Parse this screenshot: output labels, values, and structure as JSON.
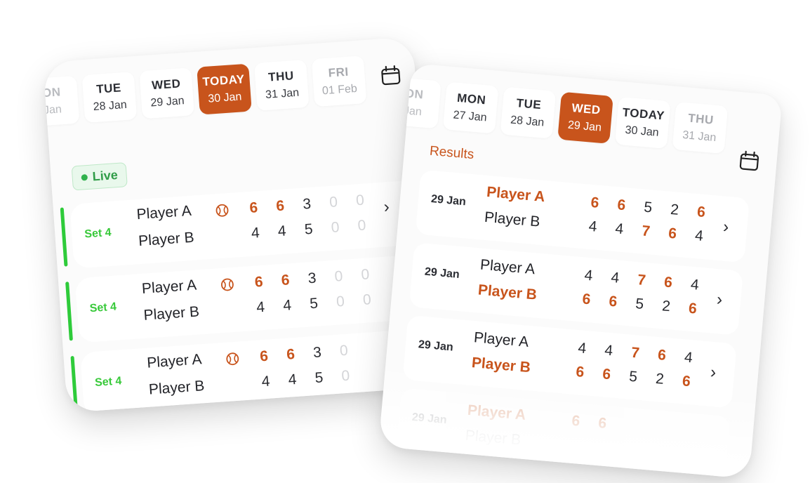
{
  "left_card": {
    "days": [
      {
        "name": "ON",
        "date": "Jan",
        "state": "edge"
      },
      {
        "name": "TUE",
        "date": "28 Jan",
        "state": "normal"
      },
      {
        "name": "WED",
        "date": "29 Jan",
        "state": "normal"
      },
      {
        "name": "TODAY",
        "date": "30 Jan",
        "state": "active"
      },
      {
        "name": "THU",
        "date": "31 Jan",
        "state": "normal"
      },
      {
        "name": "FRI",
        "date": "01 Feb",
        "state": "faded"
      }
    ],
    "live_label": "Live",
    "matches": [
      {
        "set": "Set 4",
        "player_a": "Player A",
        "player_b": "Player B",
        "a_scores": [
          "6",
          "6",
          "3",
          "0",
          "0"
        ],
        "b_scores": [
          "4",
          "4",
          "5",
          "0",
          "0"
        ]
      },
      {
        "set": "Set 4",
        "player_a": "Player A",
        "player_b": "Player B",
        "a_scores": [
          "6",
          "6",
          "3",
          "0",
          "0"
        ],
        "b_scores": [
          "4",
          "4",
          "5",
          "0",
          "0"
        ]
      },
      {
        "set": "Set 4",
        "player_a": "Player A",
        "player_b": "Player B",
        "a_scores": [
          "6",
          "6",
          "3",
          "0"
        ],
        "b_scores": [
          "4",
          "4",
          "5",
          "0"
        ]
      }
    ]
  },
  "right_card": {
    "days": [
      {
        "name": "ON",
        "date": "Jan",
        "state": "edge"
      },
      {
        "name": "MON",
        "date": "27 Jan",
        "state": "normal"
      },
      {
        "name": "TUE",
        "date": "28 Jan",
        "state": "normal"
      },
      {
        "name": "WED",
        "date": "29 Jan",
        "state": "active"
      },
      {
        "name": "TODAY",
        "date": "30 Jan",
        "state": "normal"
      },
      {
        "name": "THU",
        "date": "31 Jan",
        "state": "faded"
      }
    ],
    "results_title": "Results",
    "results": [
      {
        "date": "29 Jan",
        "player_a": "Player A",
        "player_b": "Player B",
        "winner": "a",
        "a_scores": [
          "6",
          "6",
          "5",
          "2",
          "6"
        ],
        "b_scores": [
          "4",
          "4",
          "7",
          "6",
          "4"
        ]
      },
      {
        "date": "29 Jan",
        "player_a": "Player A",
        "player_b": "Player B",
        "winner": "b",
        "a_scores": [
          "4",
          "4",
          "7",
          "6",
          "4"
        ],
        "b_scores": [
          "6",
          "6",
          "5",
          "2",
          "6"
        ]
      },
      {
        "date": "29 Jan",
        "player_a": "Player A",
        "player_b": "Player B",
        "winner": "b",
        "a_scores": [
          "4",
          "4",
          "7",
          "6",
          "4"
        ],
        "b_scores": [
          "6",
          "6",
          "5",
          "2",
          "6"
        ]
      },
      {
        "date": "29 Jan",
        "player_a": "Player A",
        "player_b": "Player B",
        "winner": "a",
        "a_scores": [
          "6",
          "6"
        ],
        "b_scores": []
      }
    ]
  },
  "colors": {
    "accent": "#c8541c",
    "live_green": "#2ecb3a",
    "card_bg": "#fbfbfb"
  },
  "icons": {
    "calendar": "calendar-icon",
    "tennis_ball": "tennis-ball-icon",
    "chevron": "chevron-right-icon",
    "live_dot": "live-dot-icon"
  }
}
